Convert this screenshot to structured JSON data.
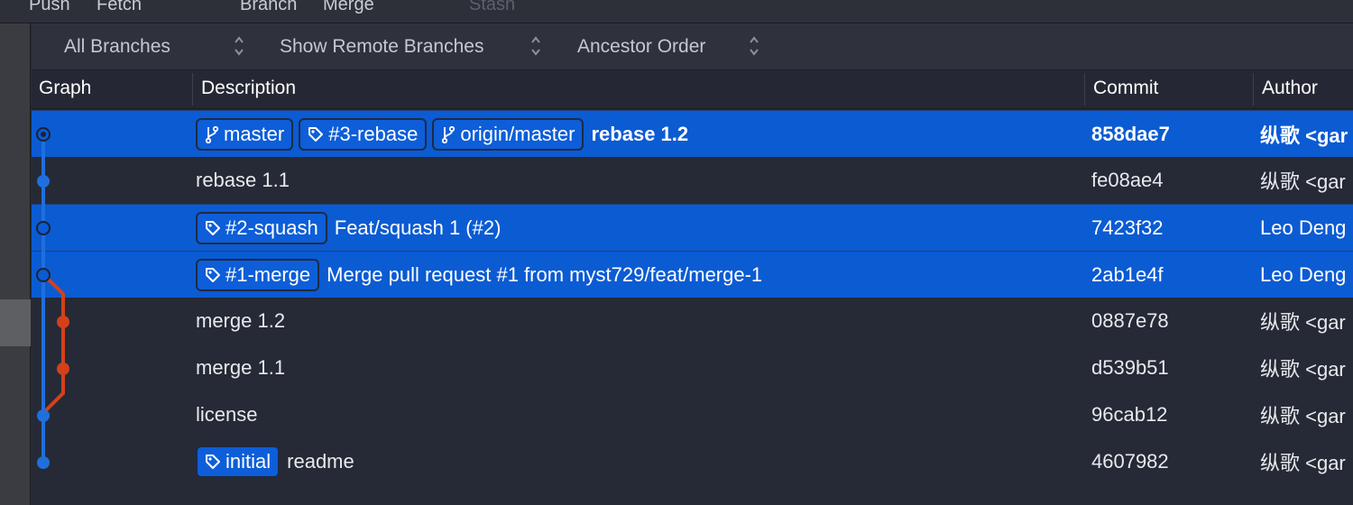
{
  "toolbar": {
    "items": [
      "Push",
      "Fetch",
      "Branch",
      "Merge",
      "Stash"
    ]
  },
  "filters": {
    "branches": "All Branches",
    "remote": "Show Remote Branches",
    "order": "Ancestor Order"
  },
  "columns": {
    "graph": "Graph",
    "description": "Description",
    "commit": "Commit",
    "author": "Author"
  },
  "commits": [
    {
      "refs": [
        {
          "type": "branch",
          "name": "master"
        },
        {
          "type": "tag",
          "name": "#3-rebase"
        },
        {
          "type": "branch",
          "name": "origin/master"
        }
      ],
      "message": "rebase 1.2",
      "hash": "858dae7",
      "author": "纵歌 <gar",
      "selected": true,
      "bold": true
    },
    {
      "refs": [],
      "message": "rebase 1.1",
      "hash": "fe08ae4",
      "author": "纵歌 <gar",
      "selected": false,
      "bold": false
    },
    {
      "refs": [
        {
          "type": "tag",
          "name": "#2-squash"
        }
      ],
      "message": "Feat/squash 1 (#2)",
      "hash": "7423f32",
      "author": "Leo Deng",
      "selected": true,
      "bold": false
    },
    {
      "refs": [
        {
          "type": "tag",
          "name": "#1-merge"
        }
      ],
      "message": "Merge pull request #1 from myst729/feat/merge-1",
      "hash": "2ab1e4f",
      "author": "Leo Deng",
      "selected": true,
      "bold": false
    },
    {
      "refs": [],
      "message": "merge 1.2",
      "hash": "0887e78",
      "author": "纵歌 <gar",
      "selected": false,
      "bold": false
    },
    {
      "refs": [],
      "message": "merge 1.1",
      "hash": "d539b51",
      "author": "纵歌 <gar",
      "selected": false,
      "bold": false
    },
    {
      "refs": [],
      "message": "license",
      "hash": "96cab12",
      "author": "纵歌 <gar",
      "selected": false,
      "bold": false
    },
    {
      "refs": [
        {
          "type": "tag",
          "name": "initial"
        }
      ],
      "message": "readme",
      "hash": "4607982",
      "author": "纵歌 <gar",
      "selected": false,
      "bold": false
    }
  ],
  "colors": {
    "selection": "#0b5bd3",
    "main_lane": "#1f6fdc",
    "branch_lane": "#d4401a",
    "background": "#262a36"
  }
}
